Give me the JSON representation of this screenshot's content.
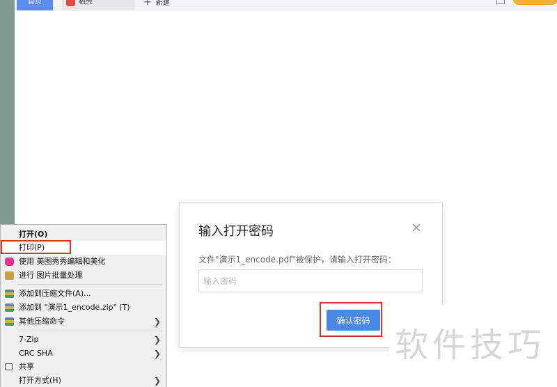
{
  "tabs": {
    "home": "首页",
    "docer": "稻壳",
    "new": "新建"
  },
  "dialog": {
    "title": "输入打开密码",
    "description": "文件\"演示1_encode.pdf\"被保护，请输入打开密码：",
    "placeholder": "输入密码",
    "value": "",
    "confirm": "确认密码"
  },
  "context_menu": {
    "items": [
      {
        "label": "打开(O)"
      },
      {
        "label": "打印(P)"
      },
      {
        "label": "使用 美图秀秀编辑和美化"
      },
      {
        "label": "进行 图片批量处理"
      },
      {
        "label": "添加到压缩文件(A)..."
      },
      {
        "label": "添加到 \"演示1_encode.zip\" (T)"
      },
      {
        "label": "其他压缩命令"
      },
      {
        "label": "7-Zip"
      },
      {
        "label": "CRC SHA"
      },
      {
        "label": "共享"
      },
      {
        "label": "打开方式(H)"
      }
    ]
  },
  "watermark": "软件技巧",
  "colors": {
    "primary_button": "#4a88e8",
    "highlight_red": "#d9312b",
    "tab_active": "#5b8def"
  }
}
